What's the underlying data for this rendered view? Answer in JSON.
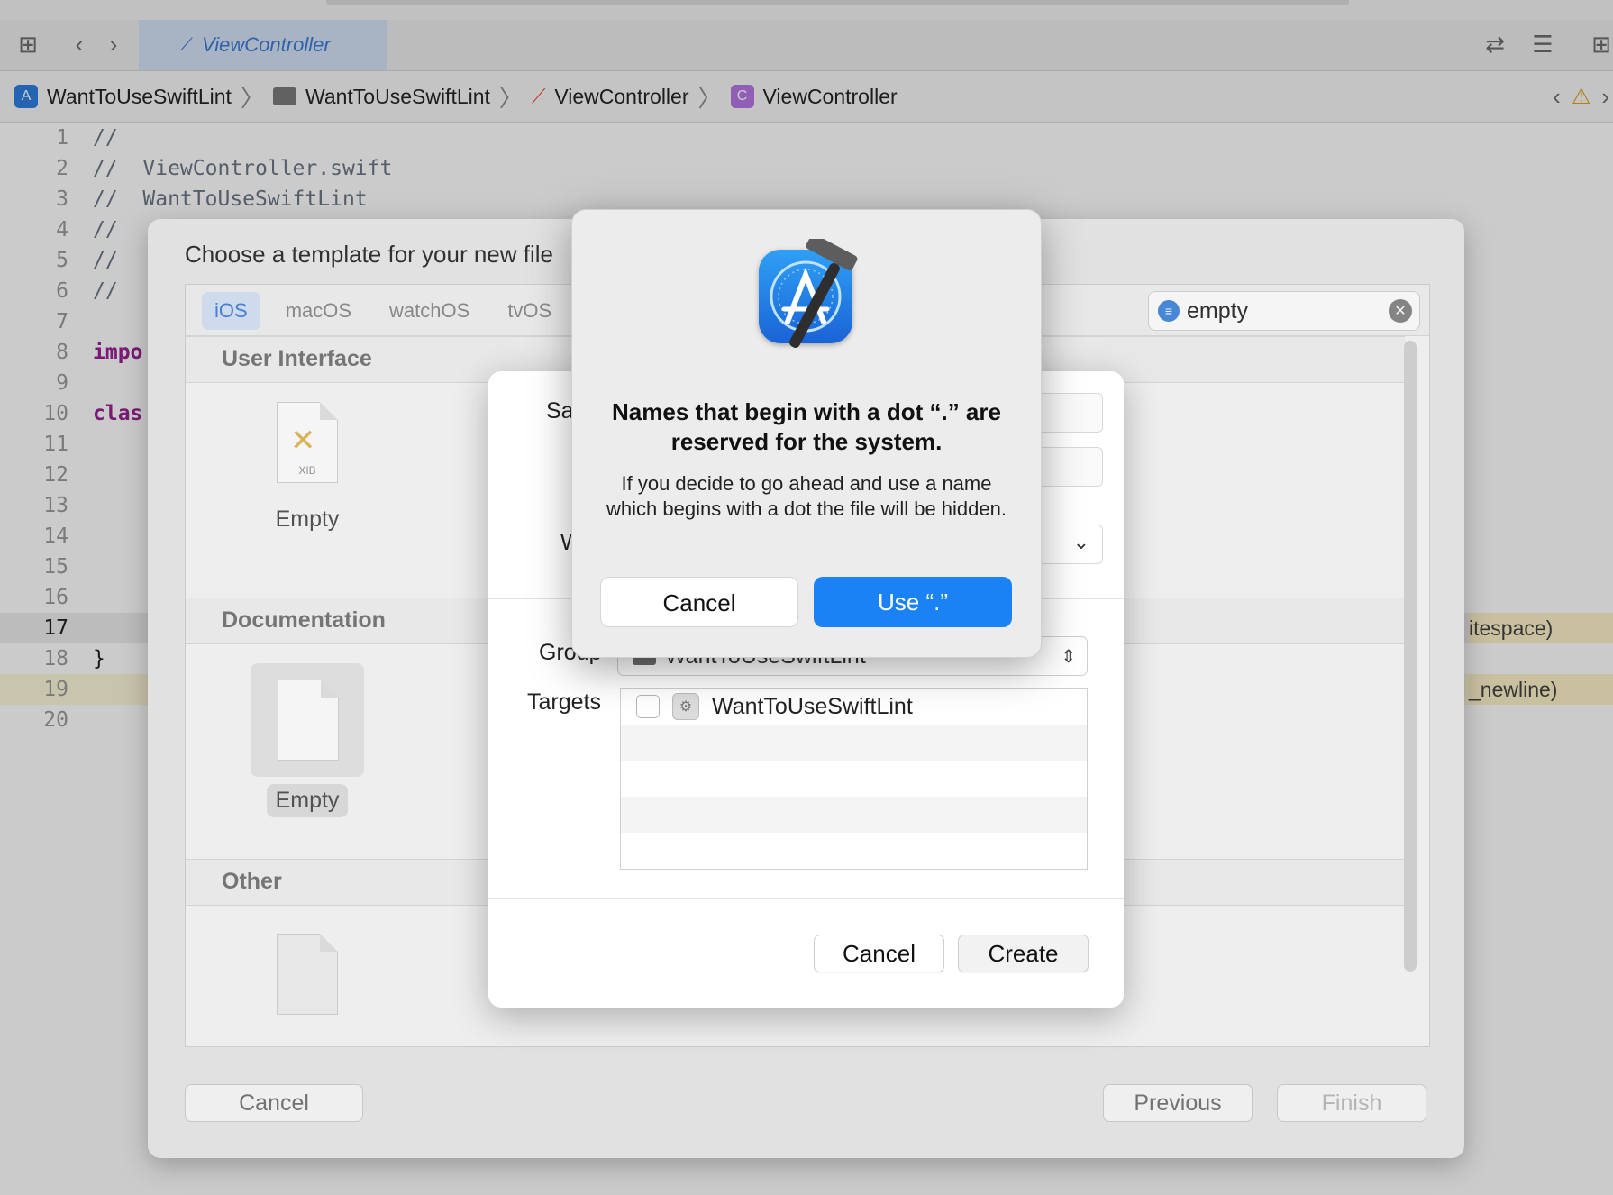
{
  "editor_tab": {
    "title": "ViewController"
  },
  "breadcrumb": {
    "project": "WantToUseSwiftLint",
    "group": "WantToUseSwiftLint",
    "file": "ViewController",
    "symbol": "ViewController",
    "project_icon_glyph": "A",
    "class_icon_glyph": "C"
  },
  "icons": {
    "layout": "sidebar-grid-icon",
    "back": "chevron-left-icon",
    "forward": "chevron-right-icon",
    "swap": "swap-arrows-icon",
    "inspectors": "inspectors-icon",
    "add_editor": "add-editor-icon",
    "warning": "warning-icon"
  },
  "code": {
    "lines": [
      {
        "n": "1",
        "text": "//",
        "style": "comment"
      },
      {
        "n": "2",
        "text": "//  ViewController.swift",
        "style": "comment"
      },
      {
        "n": "3",
        "text": "//  WantToUseSwiftLint",
        "style": "comment"
      },
      {
        "n": "4",
        "text": "//",
        "style": "comment"
      },
      {
        "n": "5",
        "text": "//",
        "style": "comment"
      },
      {
        "n": "6",
        "text": "//",
        "style": "comment"
      },
      {
        "n": "7",
        "text": "",
        "style": "comment"
      },
      {
        "n": "8",
        "text": "impo",
        "style": "keyword"
      },
      {
        "n": "9",
        "text": "",
        "style": "comment"
      },
      {
        "n": "10",
        "text": "clas",
        "style": "keyword"
      },
      {
        "n": "11",
        "text": "",
        "style": "comment"
      },
      {
        "n": "12",
        "text": "",
        "style": "comment"
      },
      {
        "n": "13",
        "text": "",
        "style": "comment"
      },
      {
        "n": "14",
        "text": "",
        "style": "comment"
      },
      {
        "n": "15",
        "text": "",
        "style": "comment"
      },
      {
        "n": "16",
        "text": "",
        "style": "comment"
      },
      {
        "n": "17",
        "text": "",
        "style": "comment"
      },
      {
        "n": "18",
        "text": "}",
        "style": "plain"
      },
      {
        "n": "19",
        "text": "",
        "style": "comment"
      },
      {
        "n": "20",
        "text": "",
        "style": "comment"
      }
    ],
    "issue_17": "itespace)",
    "issue_19": "_newline)"
  },
  "template_sheet": {
    "title": "Choose a template for your new file",
    "platform_tabs": [
      "iOS",
      "macOS",
      "watchOS",
      "tvOS"
    ],
    "filter_value": "empty",
    "sections": {
      "user_interface": "User Interface",
      "documentation": "Documentation",
      "other": "Other"
    },
    "items": {
      "xib_label": "Empty",
      "xib_badge": "XIB",
      "doc_label": "Empty"
    },
    "buttons": {
      "cancel": "Cancel",
      "previous": "Previous",
      "finish": "Finish"
    }
  },
  "save_panel": {
    "save_as_label": "Sa",
    "where_label": "W",
    "group_label": "Group",
    "group_value": "WantToUseSwiftLint",
    "targets_label": "Targets",
    "target_name": "WantToUseSwiftLint",
    "buttons": {
      "cancel": "Cancel",
      "create": "Create"
    }
  },
  "alert": {
    "title": "Names that begin with a dot “.” are reserved for the system.",
    "message": "If you decide to go ahead and use a name which begins with a dot the file will be hidden.",
    "cancel": "Cancel",
    "use": "Use “.”",
    "icon": "xcode-app-icon"
  },
  "colors": {
    "accent_blue": "#1a82f5",
    "keyword_purple": "#9b2393",
    "warning_yellow": "#e2a21b",
    "issue_highlight": "#fdf1c9"
  }
}
